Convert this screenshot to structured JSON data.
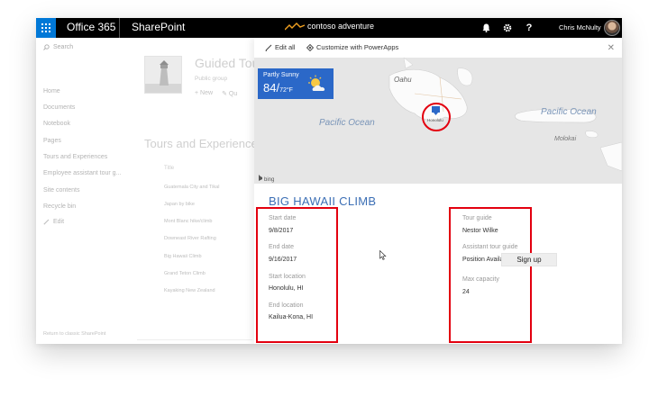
{
  "suite": {
    "app_name": "Office 365",
    "site_name": "SharePoint",
    "logo_text": "contoso adventure",
    "user_name": "Chris McNulty",
    "icons": [
      "waffle-icon",
      "bell-icon",
      "gear-icon",
      "help-icon"
    ],
    "help_label": "?"
  },
  "nav": {
    "search_placeholder": "Search",
    "items": [
      {
        "label": "Home"
      },
      {
        "label": "Documents"
      },
      {
        "label": "Notebook"
      },
      {
        "label": "Pages"
      },
      {
        "label": "Tours and Experiences"
      },
      {
        "label": "Employee assistant tour g..."
      },
      {
        "label": "Site contents"
      },
      {
        "label": "Recycle bin"
      },
      {
        "label": "Edit"
      }
    ],
    "return_link": "Return to classic SharePoint"
  },
  "site": {
    "title": "Guided Tou",
    "subtitle": "Public group",
    "new_label": "New",
    "quick_label": "Qu"
  },
  "list": {
    "title": "Tours and Experience",
    "header": "Title",
    "rows": [
      "Guatemala City and Tikal",
      "Japan by bike",
      "Mont Blanc hike/climb",
      "Downeast River Rafting",
      "Big Hawaii Climb",
      "Grand Teton Climb",
      "Kayaking New Zealand"
    ]
  },
  "panel": {
    "edit_all": "Edit all",
    "customize": "Customize with PowerApps",
    "map": {
      "ocean_labels": [
        "Pacific Ocean",
        "Pacific Ocean"
      ],
      "island_labels": [
        "Oahu",
        "Molokai",
        "Honolulu"
      ],
      "provider": "bing"
    },
    "weather": {
      "condition": "Partly Sunny",
      "temp": "84/",
      "temp_low": "72°F"
    },
    "trip_title": "BIG HAWAII CLIMB",
    "left_fields": [
      {
        "label": "Start date",
        "value": "9/8/2017"
      },
      {
        "label": "End date",
        "value": "9/16/2017"
      },
      {
        "label": "Start location",
        "value": "Honolulu, HI"
      },
      {
        "label": "End location",
        "value": "Kailua-Kona, HI"
      }
    ],
    "right_fields": [
      {
        "label": "Tour guide",
        "value": "Nestor Wilke"
      },
      {
        "label": "Assistant tour guide",
        "value": "Position Available"
      },
      {
        "label": "Max capacity",
        "value": "24"
      }
    ],
    "signup_label": "Sign up"
  },
  "colors": {
    "suite_bar": "#000000",
    "waffle": "#0078d7",
    "weather_tile": "#2b68c8",
    "highlight": "#e3000f",
    "title_blue": "#3c6fb5"
  }
}
